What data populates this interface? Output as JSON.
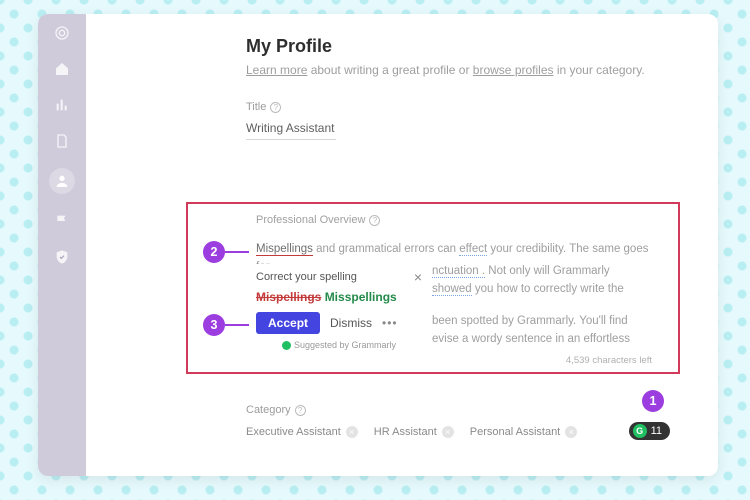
{
  "sidebar": {
    "icons": [
      "target-icon",
      "home-icon",
      "stats-icon",
      "document-icon",
      "profile-icon",
      "flag-icon",
      "shield-icon"
    ]
  },
  "page": {
    "title": "My Profile",
    "subtitle_prefix": "Learn more",
    "subtitle_mid": " about writing a great profile or ",
    "subtitle_link2": "browse profiles",
    "subtitle_suffix": " in your category."
  },
  "title_field": {
    "label": "Title",
    "value": "Writing Assistant"
  },
  "overview": {
    "label": "Professional Overview",
    "word_err": "Mispellings",
    "text_after_err": " and grammatical errors can ",
    "word_effect": "effect",
    "text_tail": " your credibility. The same goes for ",
    "frag1_line1": "nctuation .",
    "frag1_line1b": " Not only will Grammarly",
    "frag1_line2a": "showed",
    "frag1_line2b": " you how to correctly write the",
    "frag2_line1": "been spotted by Grammarly. You'll find",
    "frag2_line2": "evise a wordy sentence in an effortless",
    "char_count": "4,539 characters left"
  },
  "popup": {
    "heading": "Correct your spelling",
    "bad": "Mispellings",
    "good": "Misspellings",
    "accept": "Accept",
    "dismiss": "Dismiss",
    "suggested_by": "Suggested by Grammarly"
  },
  "category": {
    "label": "Category",
    "chips": [
      "Executive Assistant",
      "HR Assistant",
      "Personal Assistant"
    ]
  },
  "callouts": {
    "c1": "1",
    "c2": "2",
    "c3": "3"
  },
  "grammarly_badge": {
    "count": "11"
  }
}
